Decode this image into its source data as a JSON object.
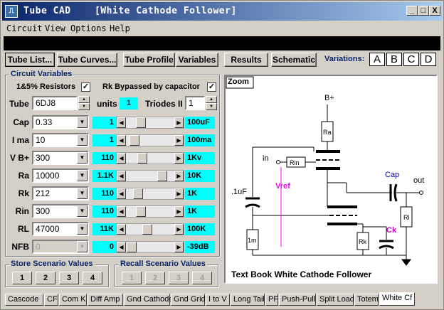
{
  "window": {
    "app_title": "Tube CAD",
    "doc_title": "[White Cathode Follower]",
    "minimize": "_",
    "maximize": "□",
    "close": "X"
  },
  "menu": [
    "Circuit",
    "View",
    "Options",
    "Help"
  ],
  "toolbar": {
    "tube_list": "Tube List...",
    "tube_curves": "Tube Curves...",
    "tube_profile": "Tube Profile",
    "variables": "Variables",
    "results": "Results",
    "schematic": "Schematic",
    "variations_label": "Variations:",
    "variations": [
      "A",
      "B",
      "C",
      "D"
    ]
  },
  "circuit_variables": {
    "title": "Circuit Variables",
    "resistors_label": "1&5% Resistors",
    "resistors_checked": "✓",
    "rk_bypass_label": "Rk Bypassed by capacitor",
    "rk_bypass_checked": "✓",
    "tube_label": "Tube",
    "tube_value": "6DJ8",
    "units_label": "units",
    "units_value": "1",
    "triodes_label": "Triodes II",
    "triodes_value": "1",
    "rows": [
      {
        "label": "Cap",
        "value": "0.33",
        "mult": "1",
        "unit": "100uF",
        "thumb": 0.25
      },
      {
        "label": "I ma",
        "value": "10",
        "mult": "1",
        "unit": "100ma",
        "thumb": 0.08
      },
      {
        "label": "V B+",
        "value": "300",
        "mult": "110",
        "unit": "1Kv",
        "thumb": 0.28
      },
      {
        "label": "Ra",
        "value": "10000",
        "mult": "1.1K",
        "unit": "10K",
        "thumb": 0.82
      },
      {
        "label": "Rk",
        "value": "212",
        "mult": "110",
        "unit": "1K",
        "thumb": 0.18
      },
      {
        "label": "Rin",
        "value": "300",
        "mult": "110",
        "unit": "1K",
        "thumb": 0.25
      },
      {
        "label": "RL",
        "value": "47000",
        "mult": "11K",
        "unit": "100K",
        "thumb": 0.42
      },
      {
        "label": "NFB",
        "value": "0",
        "mult": "0",
        "unit": "-39dB",
        "thumb": 0.0
      }
    ]
  },
  "store": {
    "title": "Store Scenario Values",
    "buttons": [
      "1",
      "2",
      "3",
      "4"
    ]
  },
  "recall": {
    "title": "Recall Scenario Values",
    "buttons": [
      "1",
      "2",
      "3",
      "4"
    ]
  },
  "schematic": {
    "zoom": "Zoom",
    "caption": "Text Book White Cathode Follower",
    "labels": {
      "bplus": "B+",
      "ra": "Ra",
      "in": "in",
      "rin": "Rin",
      "vref": "Vref",
      "cap": "Cap",
      "out": "out",
      "c1": ".1uF",
      "m1": "1m",
      "rk": "Rk",
      "ck": "Ck",
      "rl": "Rl"
    },
    "colors": {
      "vref": "#ff00ff",
      "cap": "#0000aa",
      "ck": "#cc00cc",
      "caption": "#000000"
    }
  },
  "tabs": [
    "Cascode",
    "CF",
    "Com K",
    "Diff Amp",
    "Gnd Cathode",
    "Gnd Grid",
    "I to V",
    "Long Tail",
    "PF",
    "Push-Pull",
    "Split Load",
    "Totem",
    "White Cf"
  ],
  "active_tab": "White Cf"
}
